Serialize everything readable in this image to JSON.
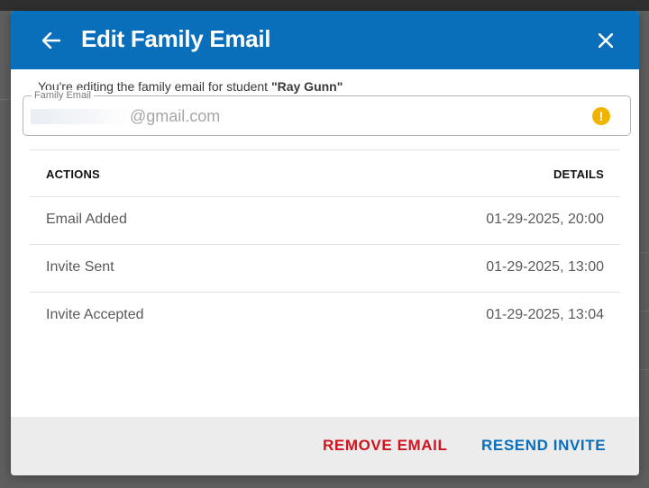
{
  "modal": {
    "title": "Edit Family Email",
    "intro_prefix": "You're editing the family email for student ",
    "student_name": "\"Ray Gunn\"",
    "email_field": {
      "legend": "Family Email",
      "value_suffix": "@gmail.com",
      "status_icon": "warning-icon"
    },
    "table": {
      "headers": {
        "actions": "ACTIONS",
        "details": "DETAILS"
      },
      "rows": [
        {
          "action": "Email Added",
          "details": "01-29-2025, 20:00"
        },
        {
          "action": "Invite Sent",
          "details": "01-29-2025, 13:00"
        },
        {
          "action": "Invite Accepted",
          "details": "01-29-2025, 13:04"
        }
      ]
    },
    "footer": {
      "remove_label": "REMOVE EMAIL",
      "resend_label": "RESEND INVITE"
    }
  },
  "colors": {
    "header_bg": "#0a6fbb",
    "remove": "#d0131f",
    "resend": "#0a6fbb",
    "warning": "#f0b400"
  },
  "icons": {
    "back": "arrow-left-icon",
    "close": "close-icon"
  }
}
